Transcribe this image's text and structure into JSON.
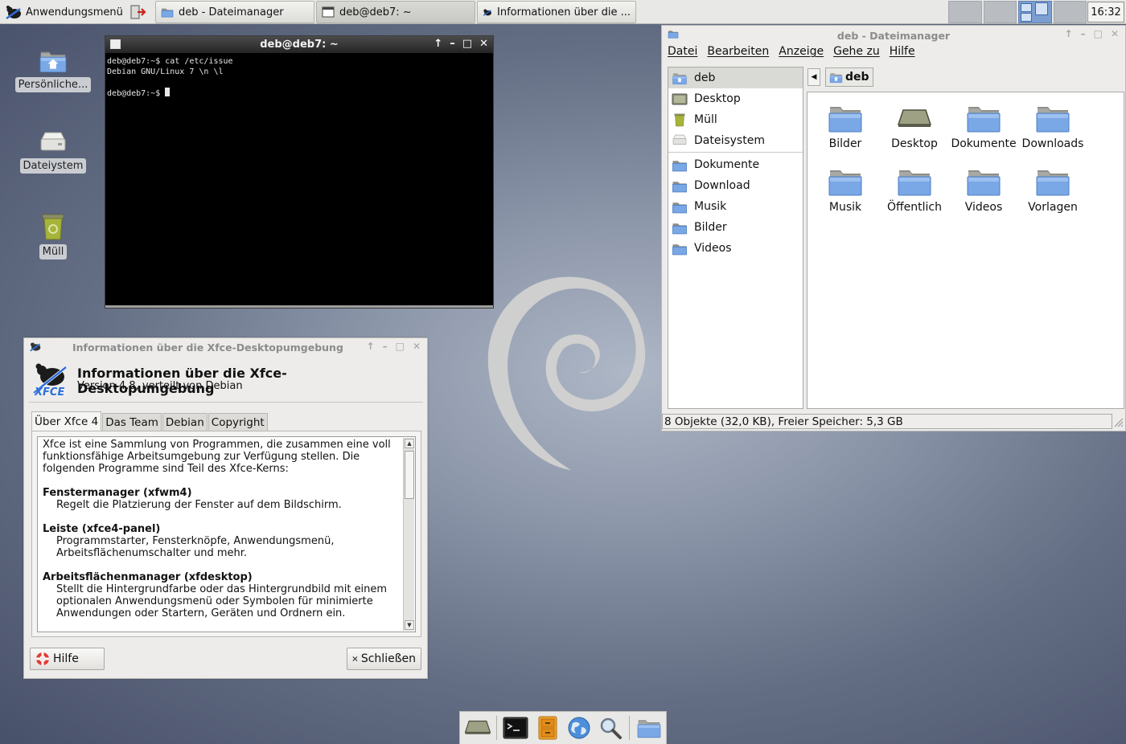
{
  "top_panel": {
    "app_menu_label": "Anwendungsmenü",
    "tasks": [
      {
        "label": "deb - Dateimanager"
      },
      {
        "label": "deb@deb7: ~"
      },
      {
        "label": "Informationen über die ..."
      }
    ],
    "clock": "16:32"
  },
  "desktop": {
    "icons": [
      {
        "label": "Persönliche..."
      },
      {
        "label": "Dateiystem"
      },
      {
        "label": "Müll"
      }
    ]
  },
  "terminal": {
    "title": "deb@deb7: ~",
    "lines": [
      "deb@deb7:~$ cat /etc/issue",
      "Debian GNU/Linux 7 \\n \\l",
      "",
      "deb@deb7:~$ "
    ]
  },
  "about": {
    "window_title": "Informationen über die Xfce-Desktopumgebung",
    "heading": "Informationen über die Xfce-Desktopumgebung",
    "version": "Version 4.8, verteilt von Debian",
    "tabs": [
      "Über Xfce 4",
      "Das Team",
      "Debian",
      "Copyright"
    ],
    "intro": "Xfce ist eine Sammlung von Programmen, die zusammen eine voll funktionsfähige Arbeitsumgebung zur Verfügung stellen. Die folgenden Programme sind Teil des Xfce-Kerns:",
    "sections": [
      {
        "title": "Fenstermanager (xfwm4)",
        "body": "Regelt die Platzierung der Fenster auf dem Bildschirm."
      },
      {
        "title": "Leiste (xfce4-panel)",
        "body": "Programmstarter, Fensterknöpfe, Anwendungsmenü, Arbeitsflächenumschalter und mehr."
      },
      {
        "title": "Arbeitsflächenmanager (xfdesktop)",
        "body": "Stellt die Hintergrundfarbe oder das Hintergrundbild mit einem optionalen Anwendungsmenü oder Symbolen für minimierte Anwendungen oder Startern, Geräten und Ordnern ein."
      }
    ],
    "help_button": "Hilfe",
    "close_button": "Schließen"
  },
  "file_manager": {
    "window_title": "deb - Dateimanager",
    "menu": [
      "Datei",
      "Bearbeiten",
      "Anzeige",
      "Gehe zu",
      "Hilfe"
    ],
    "sidebar_places": [
      "deb",
      "Desktop",
      "Müll",
      "Dateisystem"
    ],
    "sidebar_bookmarks": [
      "Dokumente",
      "Download",
      "Musik",
      "Bilder",
      "Videos"
    ],
    "path": "deb",
    "items": [
      "Bilder",
      "Desktop",
      "Dokumente",
      "Downloads",
      "Musik",
      "Öffentlich",
      "Videos",
      "Vorlagen"
    ],
    "status": "8 Objekte (32,0 KB), Freier Speicher: 5,3 GB"
  },
  "dock": {
    "icons": [
      "drive-icon",
      "terminal-icon",
      "file-cabinet-icon",
      "web-browser-icon",
      "search-icon",
      "folder-icon"
    ]
  },
  "colors": {
    "desktop_bg": "#636d83",
    "folder_blue": "#6f9fe0",
    "workspace_active": "#7c9fd2"
  }
}
